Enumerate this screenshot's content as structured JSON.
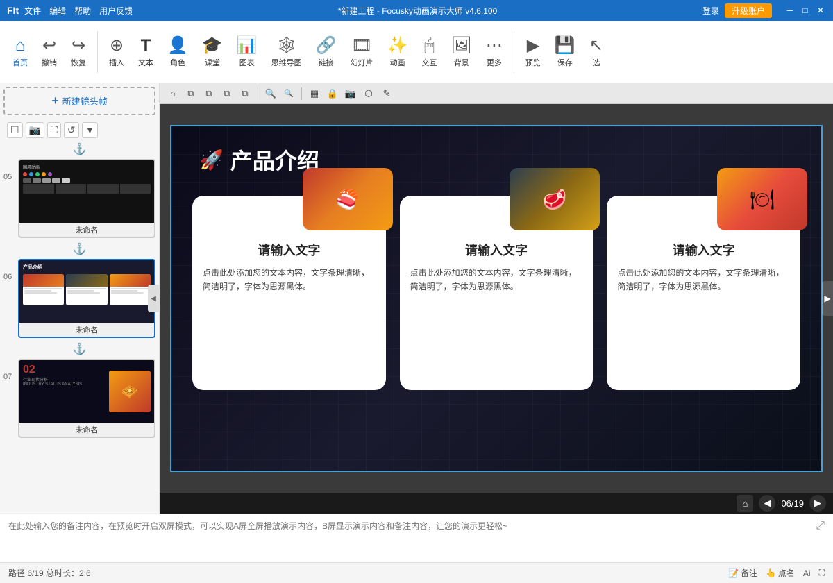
{
  "titlebar": {
    "logo": "FIt",
    "menu": [
      "文件",
      "编辑",
      "帮助",
      "用户反馈"
    ],
    "title": "*新建工程 - Focusky动画演示大师 v4.6.100",
    "login": "登录",
    "upgrade": "升级账户",
    "controls": [
      "─",
      "□",
      "✕"
    ]
  },
  "toolbar": {
    "items": [
      {
        "id": "home",
        "icon": "⌂",
        "label": "首页"
      },
      {
        "id": "undo",
        "icon": "↩",
        "label": "撤销"
      },
      {
        "id": "redo",
        "icon": "↪",
        "label": "恢复"
      },
      {
        "id": "insert",
        "icon": "⊕",
        "label": "插入"
      },
      {
        "id": "text",
        "icon": "T",
        "label": "文本"
      },
      {
        "id": "role",
        "icon": "👤",
        "label": "角色"
      },
      {
        "id": "class",
        "icon": "🎓",
        "label": "课堂"
      },
      {
        "id": "chart",
        "icon": "📊",
        "label": "图表"
      },
      {
        "id": "mindmap",
        "icon": "🧠",
        "label": "思维导图"
      },
      {
        "id": "link",
        "icon": "🔗",
        "label": "链接"
      },
      {
        "id": "slide",
        "icon": "🎞",
        "label": "幻灯片"
      },
      {
        "id": "animation",
        "icon": "✨",
        "label": "动画"
      },
      {
        "id": "interact",
        "icon": "🖱",
        "label": "交互"
      },
      {
        "id": "bg",
        "icon": "🖼",
        "label": "背景"
      },
      {
        "id": "more",
        "icon": "⋯",
        "label": "更多"
      },
      {
        "id": "preview",
        "icon": "▶",
        "label": "预览"
      },
      {
        "id": "save",
        "icon": "💾",
        "label": "保存"
      },
      {
        "id": "select",
        "icon": "↖",
        "label": "选"
      }
    ]
  },
  "canvas_toolbar": {
    "tools": [
      "⌂",
      "⧉",
      "⧉",
      "⧉",
      "⧉",
      "🔍+",
      "🔍-",
      "▦",
      "🔒",
      "📷",
      "⬡",
      "✎"
    ]
  },
  "slides": [
    {
      "number": "05",
      "name": "未命名",
      "active": false
    },
    {
      "number": "06",
      "name": "未命名",
      "active": true
    },
    {
      "number": "07",
      "name": "未命名",
      "active": false
    }
  ],
  "new_frame": "新建镜头帧",
  "slide_tools": [
    "复制帧",
    "📷",
    "⛶",
    "↺"
  ],
  "current_slide": {
    "title": "产品介绍",
    "title_icon": "🚀",
    "cards": [
      {
        "img_label": "🍣",
        "title": "请输入文字",
        "text": "点击此处添加您的文本内容，文字条理清晰，简洁明了，字体为思源黑体。"
      },
      {
        "img_label": "🥩",
        "title": "请输入文字",
        "text": "点击此处添加您的文本内容，文字条理清晰，简洁明了，字体为思源黑体。"
      },
      {
        "img_label": "🍽",
        "title": "请输入文字",
        "text": "点击此处添加您的文本内容，文字条理清晰，简洁明了，字体为思源黑体。"
      }
    ]
  },
  "nav": {
    "current": "06/19"
  },
  "notes": {
    "placeholder": "在此处输入您的备注内容，在预览时开启双屏模式，可以实现A屏全屏播放演示内容，B屏显示演示内容和备注内容，让您的演示更轻松~"
  },
  "statusbar": {
    "path": "路径 6/19  总时长：2:6",
    "notes_btn": "备注",
    "dotname_btn": "点名",
    "ai_text": "Ai"
  }
}
